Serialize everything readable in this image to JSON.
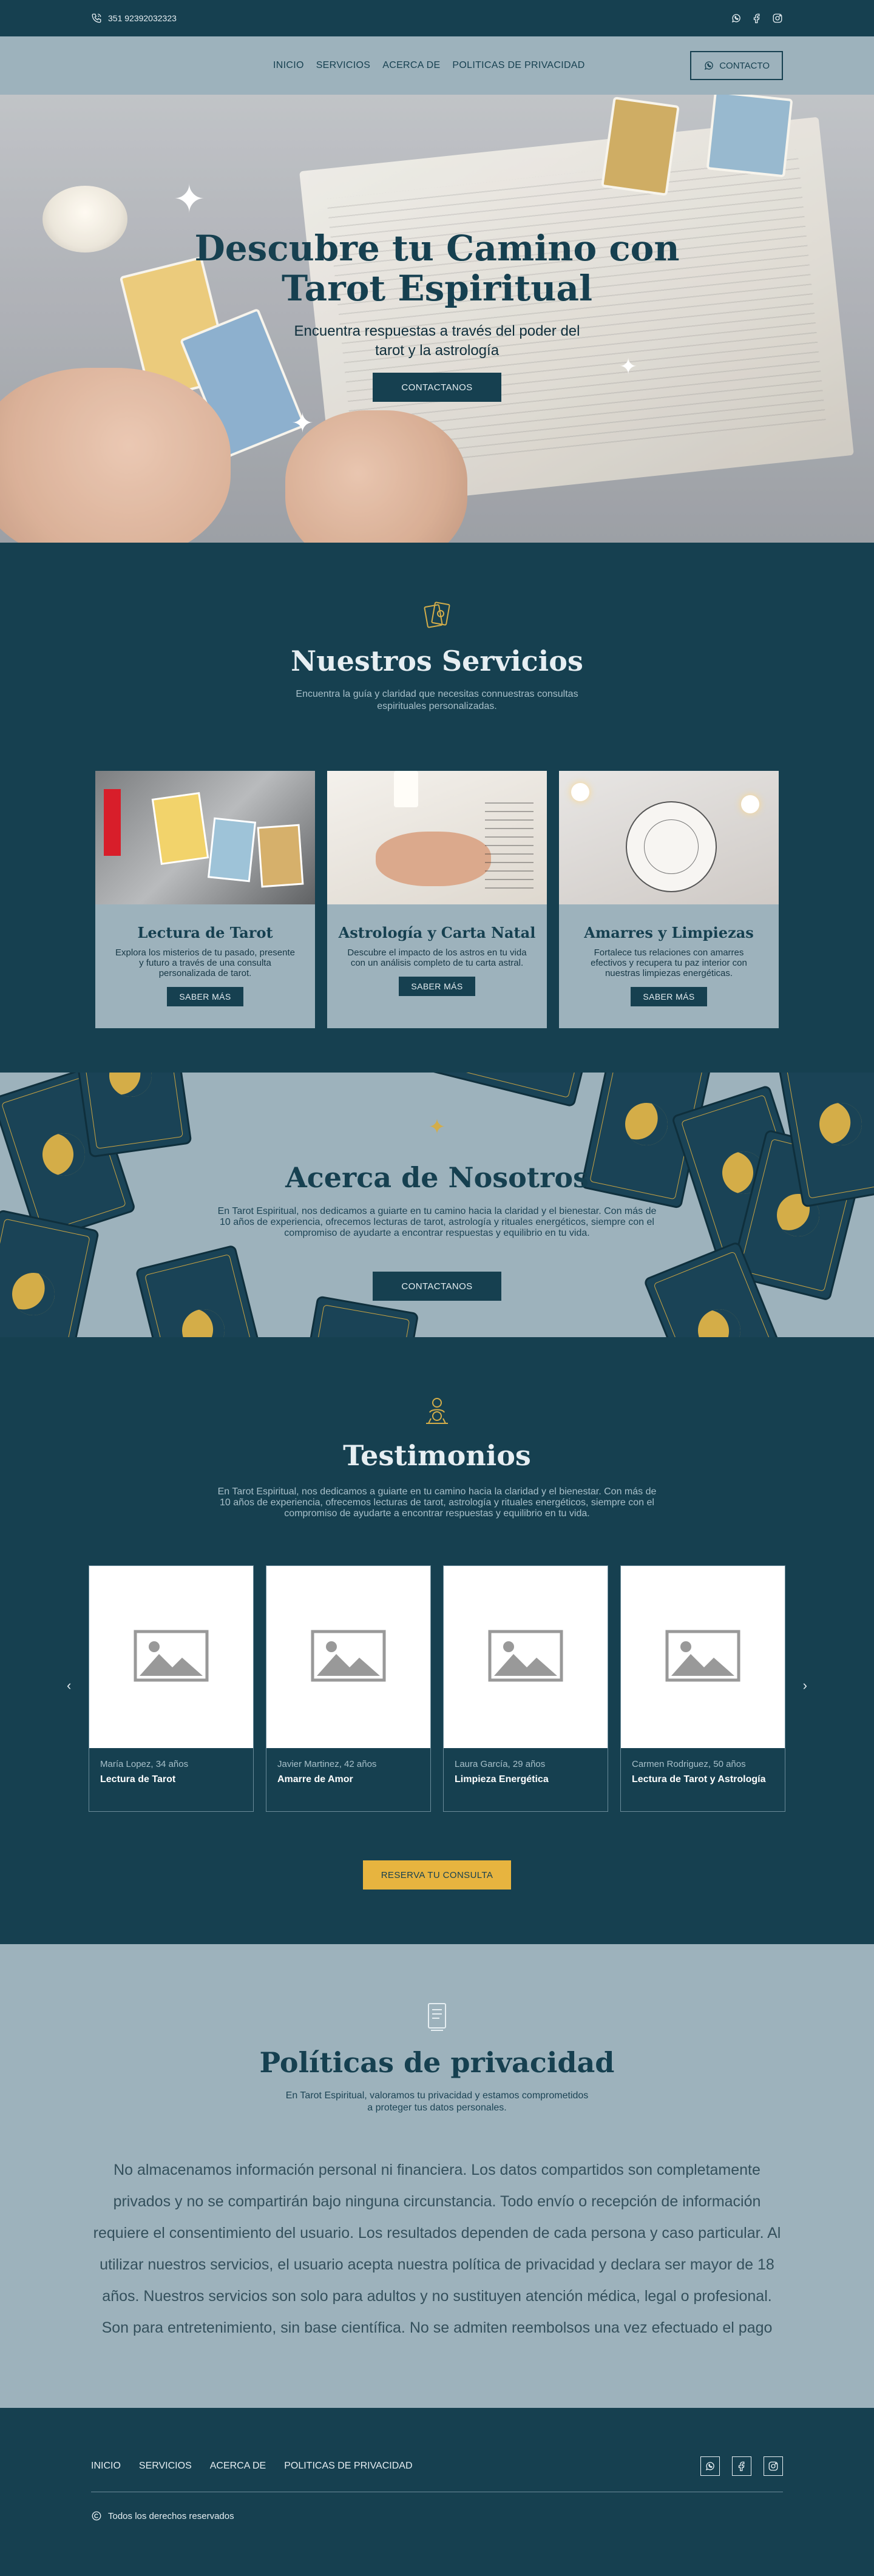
{
  "topbar": {
    "phone": "351 92392032323"
  },
  "nav": {
    "links": [
      "INICIO",
      "SERVICIOS",
      "ACERCA DE",
      "POLITICAS DE PRIVACIDAD"
    ],
    "contact_button": "CONTACTO"
  },
  "hero": {
    "title_line1": "Descubre tu Camino con",
    "title_line2": "Tarot Espiritual",
    "subtitle": "Encuentra respuestas a través del poder del tarot y la astrología",
    "button": "CONTACTANOS"
  },
  "services": {
    "title": "Nuestros Servicios",
    "subtitle": "Encuentra la guía y claridad que necesitas connuestras consultas espirituales personalizadas.",
    "items": [
      {
        "title": "Lectura de Tarot",
        "description": "Explora los misterios de tu pasado, presente y futuro a través de una consulta personalizada de tarot.",
        "button": "SABER MÁS"
      },
      {
        "title": "Astrología y Carta Natal",
        "description": "Descubre el impacto de los astros en tu vida con un análisis completo de tu carta astral.",
        "button": "SABER MÁS"
      },
      {
        "title": "Amarres y Limpiezas",
        "description": "Fortalece tus relaciones con amarres efectivos y recupera tu paz interior con nuestras limpiezas energéticas.",
        "button": "SABER MÁS"
      }
    ]
  },
  "about": {
    "title": "Acerca de Nosotros",
    "text": "En Tarot Espiritual, nos dedicamos a guiarte en tu camino hacia la claridad y el bienestar. Con más de 10 años de experiencia, ofrecemos lecturas de tarot, astrología y rituales energéticos, siempre con el compromiso de ayudarte a encontrar respuestas y equilibrio en tu vida.",
    "button": "CONTACTANOS"
  },
  "testimonials": {
    "title": "Testimonios",
    "text": "En Tarot Espiritual, nos dedicamos a guiarte en tu camino hacia la claridad y el bienestar. Con más de 10 años de experiencia, ofrecemos lecturas de tarot, astrología y rituales energéticos, siempre con el compromiso de ayudarte a encontrar respuestas y equilibrio en tu vida.",
    "items": [
      {
        "who": "María Lopez, 34 años",
        "service": "Lectura de Tarot"
      },
      {
        "who": "Javier Martinez, 42 años",
        "service": "Amarre de Amor"
      },
      {
        "who": "Laura García, 29 años",
        "service": "Limpieza Energética"
      },
      {
        "who": "Carmen Rodriguez, 50 años",
        "service": "Lectura de Tarot y Astrología"
      }
    ],
    "button": "RESERVA TU CONSULTA"
  },
  "privacy": {
    "title": "Políticas de privacidad",
    "subtitle": "En Tarot Espiritual, valoramos tu privacidad y estamos comprometidos a proteger tus datos personales.",
    "body": "No almacenamos información personal ni financiera. Los datos compartidos son completamente privados y no se compartirán bajo ninguna circunstancia. Todo envío o recepción de información requiere el consentimiento del usuario. Los resultados dependen de cada persona y caso particular. Al utilizar nuestros servicios, el usuario acepta nuestra política de privacidad y declara ser mayor de 18 años. Nuestros servicios son solo para adultos y no sustituyen atención médica, legal o profesional. Son para entretenimiento, sin base científica. No se admiten reembolsos una vez efectuado el pago"
  },
  "footer": {
    "links": [
      "INICIO",
      "SERVICIOS",
      "ACERCA DE",
      "POLITICAS DE PRIVACIDAD"
    ],
    "copyright": "Todos los derechos reservados"
  },
  "colors": {
    "primary": "#164050",
    "secondary": "#9db2bc",
    "accent_gold": "#e7b43f"
  },
  "icons": [
    "phone-icon",
    "whatsapp-icon",
    "facebook-icon",
    "instagram-icon",
    "tarot-cards-icon",
    "fortune-teller-icon",
    "document-icon",
    "copyright-icon",
    "chevron-left-icon",
    "chevron-right-icon",
    "image-placeholder-icon",
    "sparkle-icon"
  ]
}
